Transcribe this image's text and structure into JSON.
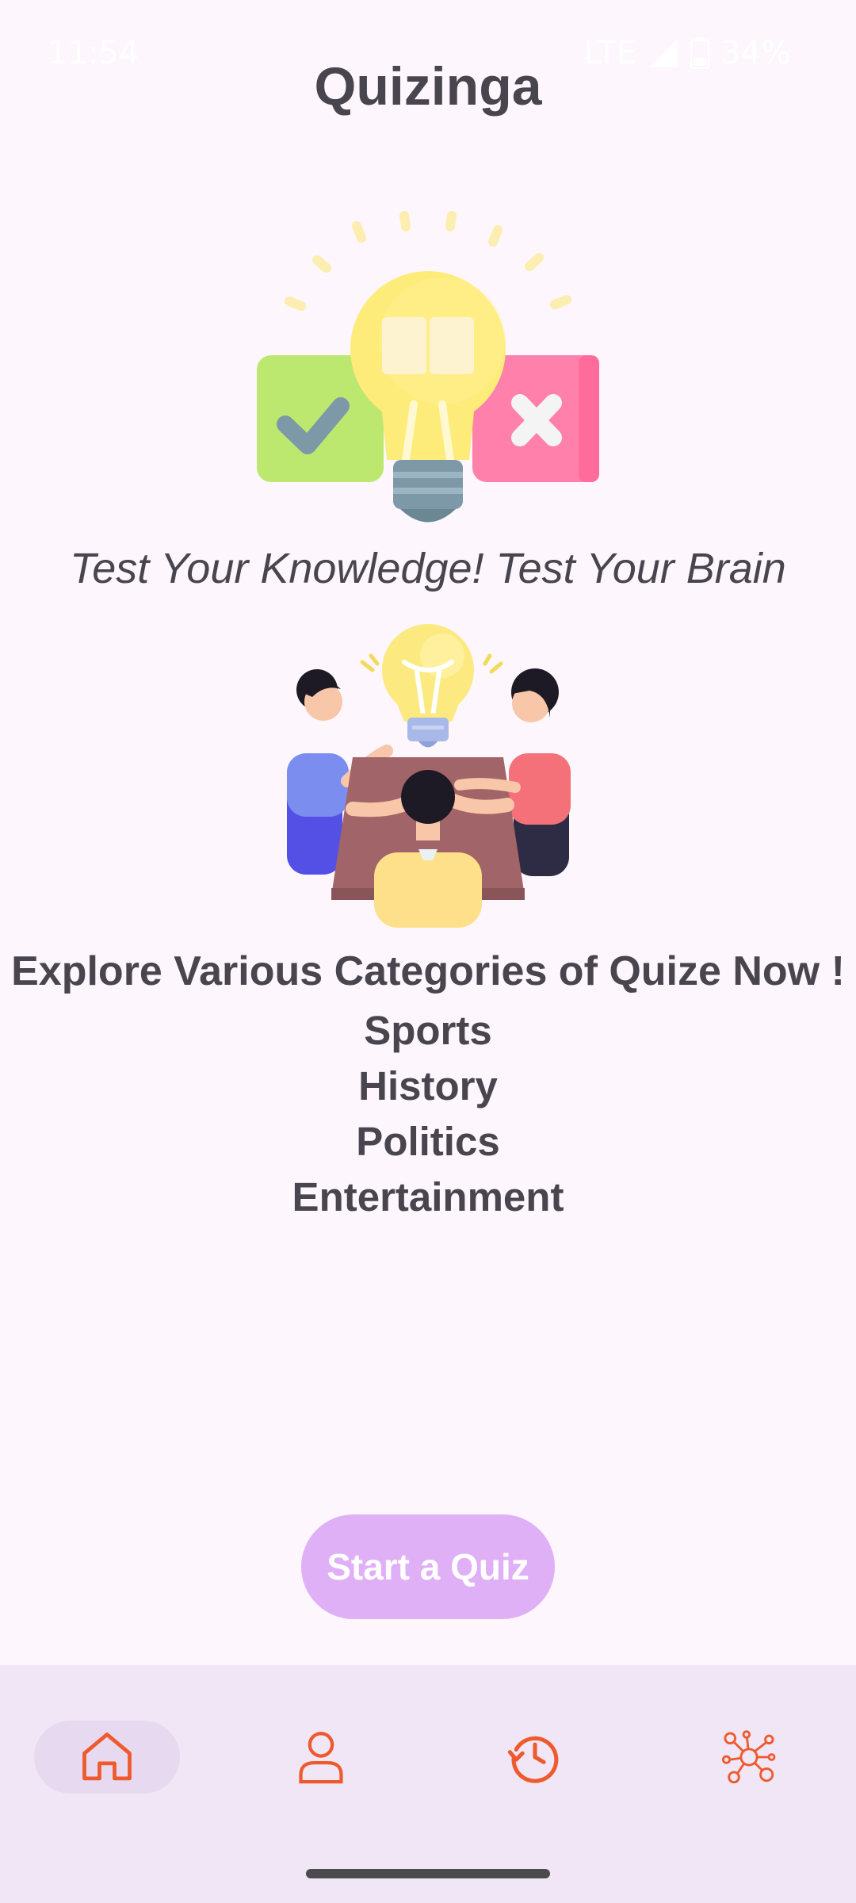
{
  "status": {
    "time": "11:54",
    "network": "LTE",
    "battery": "34%"
  },
  "app": {
    "title": "Quizinga"
  },
  "hero": {
    "tagline": "Test Your Knowledge! Test Your Brain",
    "explore_text": "Explore Various Categories of Quize Now !"
  },
  "categories": [
    "Sports",
    "History",
    "Politics",
    "Entertainment"
  ],
  "actions": {
    "start_label": "Start a Quiz"
  },
  "nav": {
    "items": [
      {
        "icon": "home-icon",
        "active": true
      },
      {
        "icon": "profile-icon",
        "active": false
      },
      {
        "icon": "history-icon",
        "active": false
      },
      {
        "icon": "network-icon",
        "active": false
      }
    ]
  },
  "colors": {
    "background": "#fdf6fd",
    "button": "#e0b0f7",
    "nav_background": "#f0e6f5",
    "nav_icon": "#ee5a2d",
    "text": "#49454f"
  }
}
